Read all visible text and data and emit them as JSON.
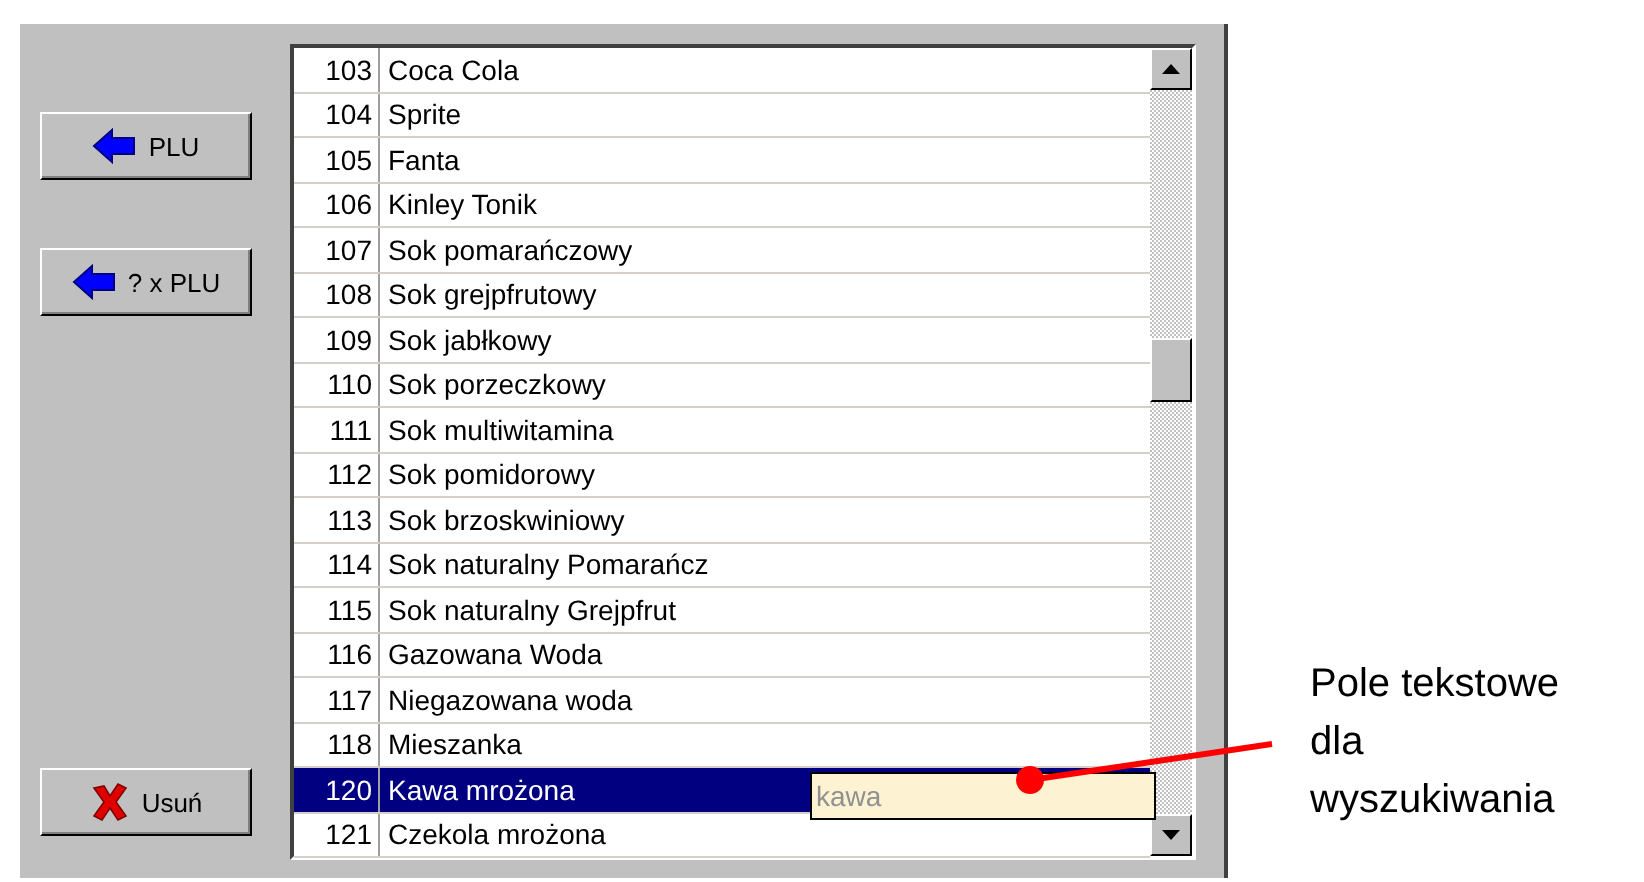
{
  "buttons": [
    {
      "kind": "arrow",
      "label": "PLU"
    },
    {
      "kind": "arrow",
      "label": "? x PLU"
    },
    {
      "kind": "delete",
      "label": "Usuń"
    }
  ],
  "list": {
    "rows": [
      {
        "number": "103",
        "name": "Coca Cola",
        "selected": false
      },
      {
        "number": "104",
        "name": "Sprite",
        "selected": false
      },
      {
        "number": "105",
        "name": "Fanta",
        "selected": false
      },
      {
        "number": "106",
        "name": "Kinley Tonik",
        "selected": false
      },
      {
        "number": "107",
        "name": "Sok pomarańczowy",
        "selected": false
      },
      {
        "number": "108",
        "name": "Sok grejpfrutowy",
        "selected": false
      },
      {
        "number": "109",
        "name": "Sok jabłkowy",
        "selected": false
      },
      {
        "number": "110",
        "name": "Sok porzeczkowy",
        "selected": false
      },
      {
        "number": "111",
        "name": "Sok multiwitamina",
        "selected": false
      },
      {
        "number": "112",
        "name": "Sok pomidorowy",
        "selected": false
      },
      {
        "number": "113",
        "name": "Sok brzoskwiniowy",
        "selected": false
      },
      {
        "number": "114",
        "name": "Sok naturalny Pomarańcz",
        "selected": false
      },
      {
        "number": "115",
        "name": "Sok naturalny Grejpfrut",
        "selected": false
      },
      {
        "number": "116",
        "name": "Gazowana Woda",
        "selected": false
      },
      {
        "number": "117",
        "name": "Niegazowana woda",
        "selected": false
      },
      {
        "number": "118",
        "name": "Mieszanka",
        "selected": false
      },
      {
        "number": "120",
        "name": "Kawa mrożona",
        "selected": true
      },
      {
        "number": "121",
        "name": "Czekola mrożona",
        "selected": false
      }
    ]
  },
  "search_field": {
    "value": "kawa"
  },
  "annotation": {
    "text": "Pole tekstowe dla wyszukiwania"
  }
}
